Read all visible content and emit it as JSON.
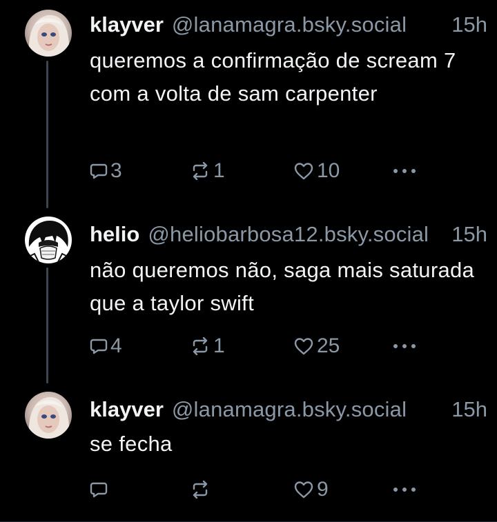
{
  "colors": {
    "background": "#000000",
    "text": "#f1f3f5",
    "muted": "#8b98a5",
    "thread_line": "#3b4652"
  },
  "posts": [
    {
      "display_name": "klayver",
      "handle": "@lanamagra.bsky.social",
      "time": "15h",
      "text": "queremos a confirmação de scream 7 com a volta de sam carpenter",
      "avatar_icon": "blonde-person-avatar",
      "replies": "3",
      "reposts": "1",
      "likes": "10",
      "more_icon": "more-dots-icon"
    },
    {
      "display_name": "helio",
      "handle": "@heliobarbosa12.bsky.social",
      "time": "15h",
      "text": "não queremos não, saga mais saturada que a taylor swift",
      "avatar_icon": "anime-masked-avatar",
      "replies": "4",
      "reposts": "1",
      "likes": "25",
      "more_icon": "more-dots-icon"
    },
    {
      "display_name": "klayver",
      "handle": "@lanamagra.bsky.social",
      "time": "15h",
      "text": "se fecha",
      "avatar_icon": "blonde-person-avatar",
      "replies": "",
      "reposts": "",
      "likes": "9",
      "more_icon": "more-dots-icon"
    }
  ]
}
